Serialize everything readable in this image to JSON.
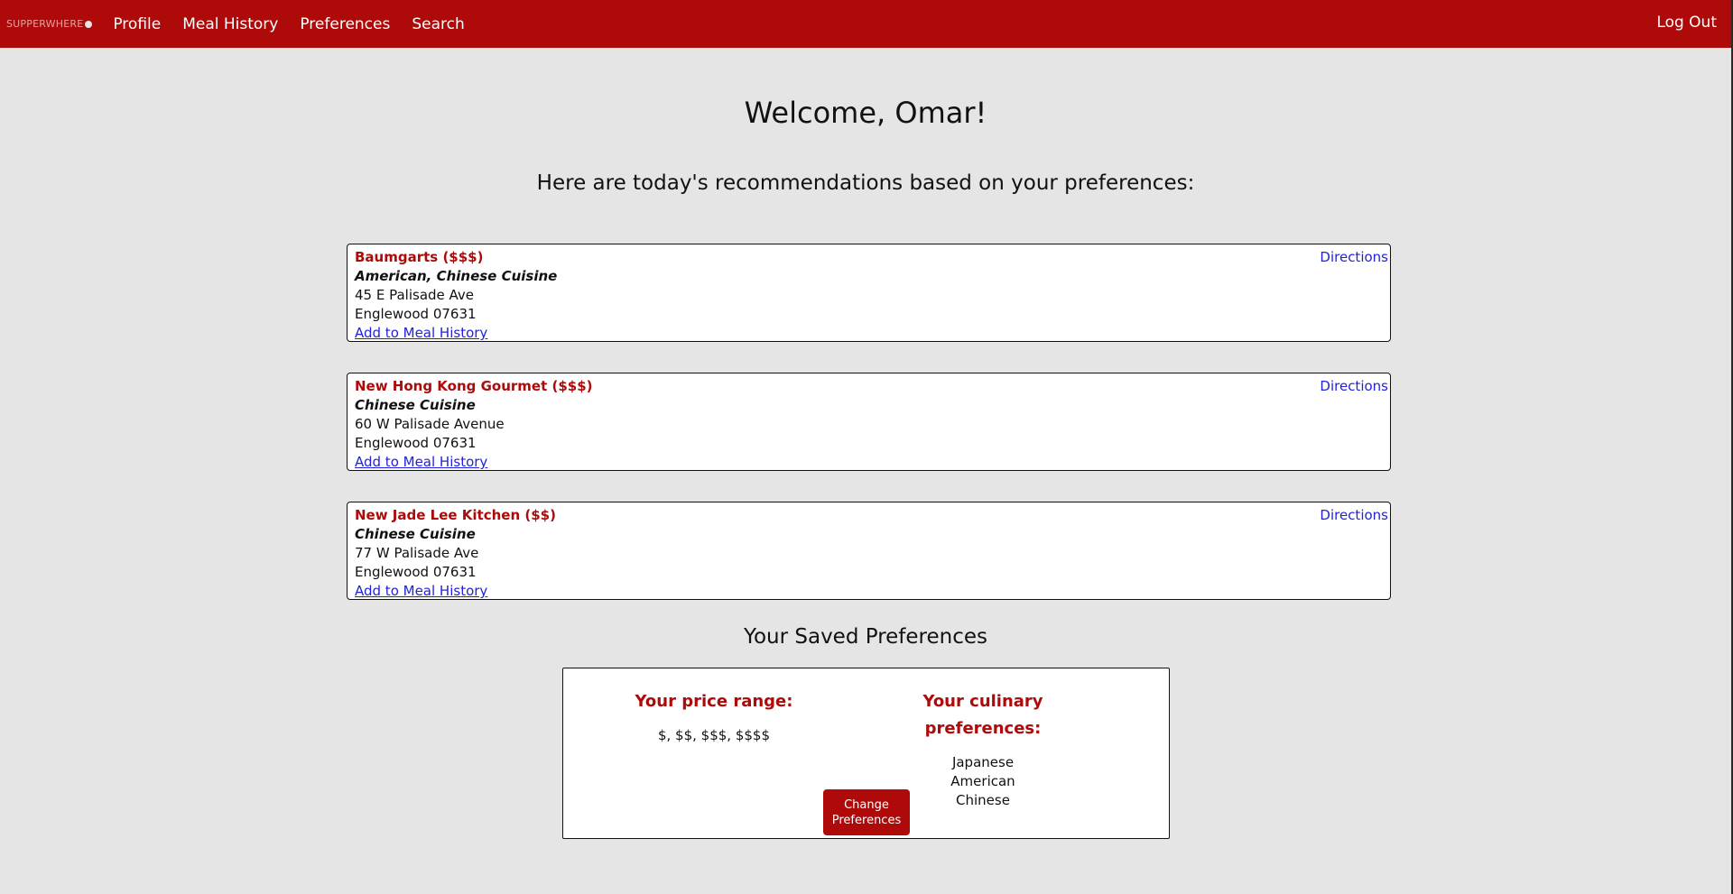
{
  "nav": {
    "brand": "SUPPERWHERE",
    "links": [
      "Profile",
      "Meal History",
      "Preferences",
      "Search"
    ],
    "logout": "Log Out"
  },
  "main": {
    "welcome": "Welcome, Omar!",
    "subtitle": "Here are today's recommendations based on your preferences:"
  },
  "recommendations": [
    {
      "name": "Baumgarts ($$$)",
      "cuisine": "American, Chinese Cuisine",
      "address": "45 E Palisade Ave",
      "city": "Englewood 07631",
      "add_link": "Add to Meal History",
      "directions": "Directions"
    },
    {
      "name": "New Hong Kong Gourmet ($$$)",
      "cuisine": "Chinese Cuisine",
      "address": "60 W Palisade Avenue",
      "city": "Englewood 07631",
      "add_link": "Add to Meal History",
      "directions": "Directions"
    },
    {
      "name": "New Jade Lee Kitchen ($$)",
      "cuisine": "Chinese Cuisine",
      "address": "77 W Palisade Ave",
      "city": "Englewood 07631",
      "add_link": "Add to Meal History",
      "directions": "Directions"
    }
  ],
  "saved": {
    "title": "Your Saved Preferences",
    "price_heading": "Your price range:",
    "price_value": "$, $$, $$$, $$$$",
    "culinary_heading": "Your culinary preferences:",
    "culinary": [
      "Japanese",
      "American",
      "Chinese"
    ],
    "change_button_line1": "Change",
    "change_button_line2": "Preferences"
  },
  "colors": {
    "brand": "#ae0a0a",
    "background": "#e5e5e5",
    "link": "#2222dd"
  }
}
